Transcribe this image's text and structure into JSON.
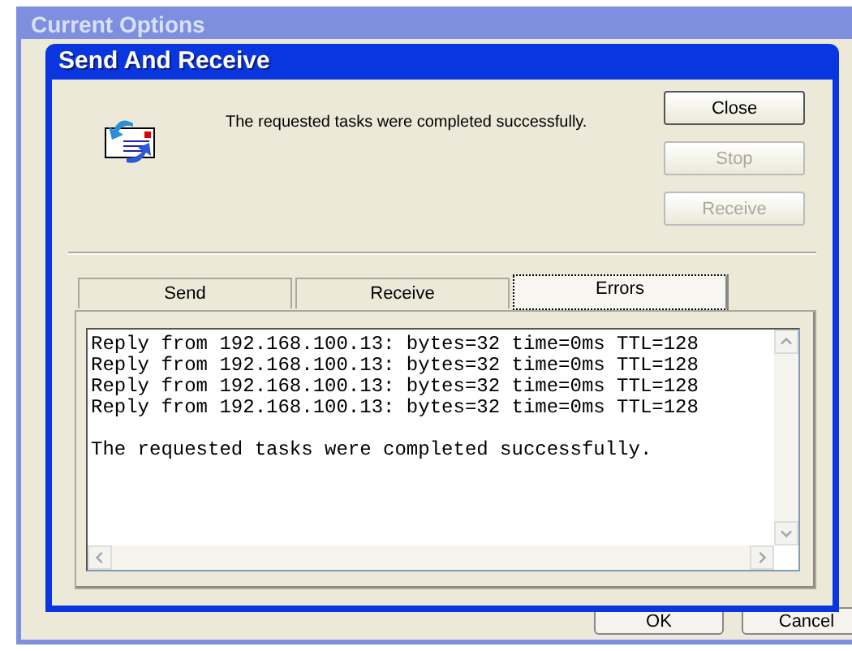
{
  "background_window": {
    "title": "Current Options",
    "buttons": [
      {
        "label": "OK"
      },
      {
        "label": "Cancel"
      }
    ]
  },
  "dialog": {
    "title": "Send And Receive",
    "message": "The requested tasks were completed successfully.",
    "buttons": [
      {
        "label": "Close",
        "disabled": false
      },
      {
        "label": "Stop",
        "disabled": true
      },
      {
        "label": "Receive",
        "disabled": true
      }
    ],
    "tabs": [
      {
        "label": "Send",
        "selected": false
      },
      {
        "label": "Receive",
        "selected": false
      },
      {
        "label": "Errors",
        "selected": true
      }
    ],
    "log_lines": [
      "Reply from 192.168.100.13: bytes=32 time=0ms TTL=128",
      "Reply from 192.168.100.13: bytes=32 time=0ms TTL=128",
      "Reply from 192.168.100.13: bytes=32 time=0ms TTL=128",
      "Reply from 192.168.100.13: bytes=32 time=0ms TTL=128"
    ],
    "log_summary": "The requested tasks were completed successfully."
  }
}
